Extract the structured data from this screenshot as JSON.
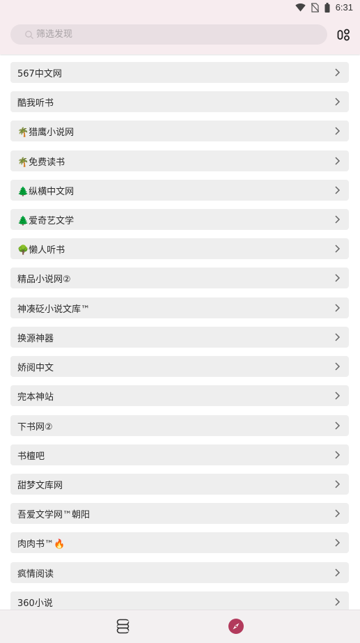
{
  "status_bar": {
    "time": "6:31"
  },
  "search": {
    "placeholder": "筛选发现"
  },
  "sources": [
    {
      "label": "567中文网"
    },
    {
      "label": "酷我听书"
    },
    {
      "label": "🌴猎鹰小说网"
    },
    {
      "label": "🌴免费读书"
    },
    {
      "label": "🌲纵横中文网"
    },
    {
      "label": "🌲爱奇艺文学"
    },
    {
      "label": "🌳懒人听书"
    },
    {
      "label": "精品小说网②"
    },
    {
      "label": "神凑砭小说文库™"
    },
    {
      "label": "换源神器"
    },
    {
      "label": "娇阅中文"
    },
    {
      "label": "完本神站"
    },
    {
      "label": "下书网②"
    },
    {
      "label": "书檀吧"
    },
    {
      "label": "甜梦文库网"
    },
    {
      "label": "吾爱文学网™朝阳"
    },
    {
      "label": "肉肉书™🔥"
    },
    {
      "label": "疯情阅读"
    },
    {
      "label": "360小说"
    }
  ],
  "colors": {
    "header_bg": "#f7ecef",
    "item_bg": "#eeeeee",
    "accent": "#b23a5c",
    "bottom_bg": "#f3f0f1"
  },
  "icons": {
    "search": "search-icon",
    "group": "group-icon",
    "chevron": "chevron-right-icon",
    "bookshelf": "bookshelf-icon",
    "discover": "compass-icon"
  }
}
